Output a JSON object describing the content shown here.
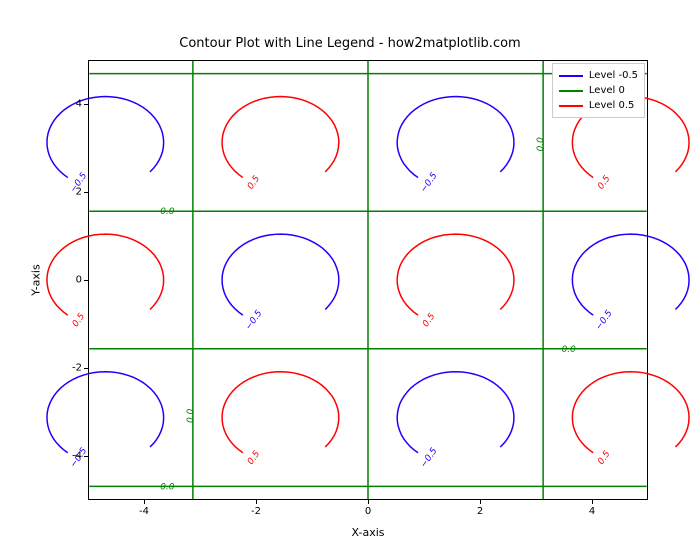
{
  "chart_data": {
    "type": "contour",
    "title": "Contour Plot with Line Legend - how2matplotlib.com",
    "xlabel": "X-axis",
    "ylabel": "Y-axis",
    "xlim": [
      -5,
      5
    ],
    "ylim": [
      -5,
      5
    ],
    "xticks": [
      -4,
      -2,
      0,
      2,
      4
    ],
    "yticks": [
      -4,
      -2,
      0,
      2,
      4
    ],
    "function": "sin(x)*cos(y)",
    "levels": [
      -0.5,
      0.0,
      0.5
    ],
    "level_colors": {
      "-0.5": "#1f00ff",
      "0.0": "#008000",
      "0.5": "#ff0000"
    },
    "legend": [
      {
        "label": "Level -0.5",
        "color": "#1f00ff"
      },
      {
        "label": "Level 0",
        "color": "#008000"
      },
      {
        "label": "Level 0.5",
        "color": "#ff0000"
      }
    ],
    "zero_grid": {
      "vlines_x": [
        -3.1416,
        0,
        3.1416
      ],
      "hlines_y": [
        -4.7124,
        -1.5708,
        1.5708,
        4.7124
      ]
    },
    "lobes": [
      {
        "cx": -4.7124,
        "cy": 3.1416,
        "level": -0.5
      },
      {
        "cx": -1.5708,
        "cy": 3.1416,
        "level": 0.5
      },
      {
        "cx": 1.5708,
        "cy": 3.1416,
        "level": -0.5
      },
      {
        "cx": 4.7124,
        "cy": 3.1416,
        "level": 0.5
      },
      {
        "cx": -4.7124,
        "cy": 0.0,
        "level": 0.5
      },
      {
        "cx": -1.5708,
        "cy": 0.0,
        "level": -0.5
      },
      {
        "cx": 1.5708,
        "cy": 0.0,
        "level": 0.5
      },
      {
        "cx": 4.7124,
        "cy": 0.0,
        "level": -0.5
      },
      {
        "cx": -4.7124,
        "cy": -3.1416,
        "level": -0.5
      },
      {
        "cx": -1.5708,
        "cy": -3.1416,
        "level": 0.5
      },
      {
        "cx": 1.5708,
        "cy": -3.1416,
        "level": -0.5
      },
      {
        "cx": 4.7124,
        "cy": -3.1416,
        "level": 0.5
      }
    ],
    "inline_labels": {
      "-0.5": "−0.5",
      "0.0": "0.0",
      "0.5": "0.5"
    }
  }
}
